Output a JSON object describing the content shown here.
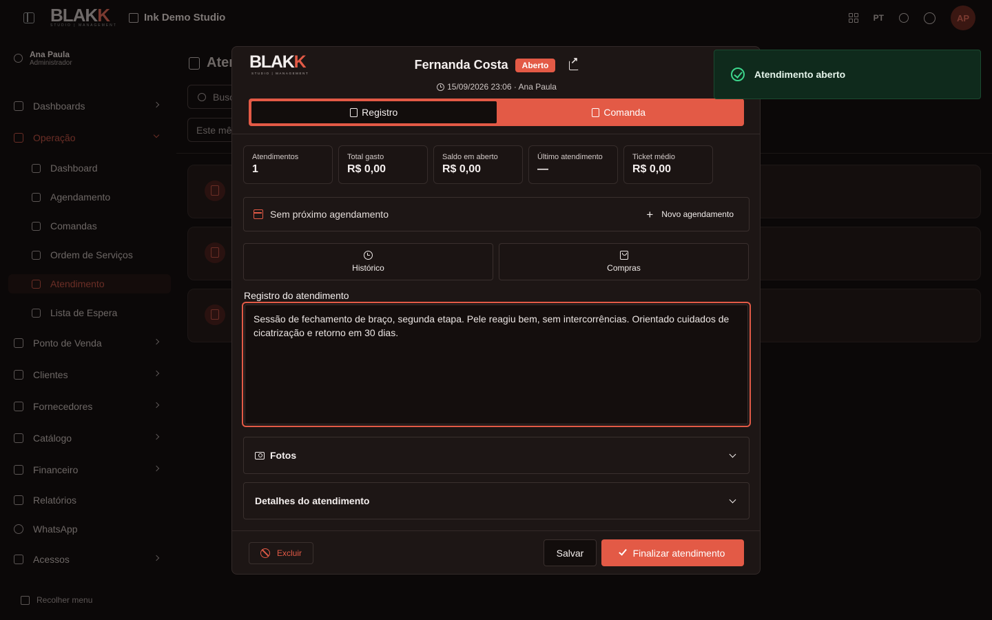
{
  "topbar": {
    "logo_main": "BLAK",
    "logo_accent": "K",
    "logo_sub": "STUDIO | MANAGEMENT",
    "studio_name": "Ink Demo Studio",
    "language": "PT",
    "avatar_initials": "AP"
  },
  "sidebar": {
    "user_name": "Ana Paula",
    "user_role": "Administrador",
    "items": {
      "dashboards": "Dashboards",
      "operacao": "Operação",
      "ponto_venda": "Ponto de Venda",
      "clientes": "Clientes",
      "fornecedores": "Fornecedores",
      "catalogo": "Catálogo",
      "financeiro": "Financeiro",
      "relatorios": "Relatórios",
      "whatsapp": "WhatsApp",
      "acessos": "Acessos"
    },
    "sub_items": {
      "dashboard": "Dashboard",
      "agendamento": "Agendamento",
      "comandas": "Comandas",
      "ordem_servicos": "Ordem de Serviços",
      "atendimento": "Atendimento",
      "lista_espera": "Lista de Espera"
    },
    "collapse_label": "Recolher menu"
  },
  "background": {
    "page_title": "Ater",
    "search_placeholder": "Busc",
    "filter_value": "Este mê"
  },
  "toast": {
    "message": "Atendimento aberto"
  },
  "modal": {
    "logo_main": "BLAK",
    "logo_accent": "K",
    "logo_sub": "STUDIO | MANAGEMENT",
    "client_name": "Fernanda Costa",
    "status": "Aberto",
    "datetime_author": "15/09/2026 23:06 · Ana Paula",
    "tabs": {
      "registro": "Registro",
      "comanda": "Comanda"
    },
    "stats": [
      {
        "label": "Atendimentos",
        "value": "1"
      },
      {
        "label": "Total gasto",
        "value": "R$ 0,00"
      },
      {
        "label": "Saldo em aberto",
        "value": "R$ 0,00"
      },
      {
        "label": "Último atendimento",
        "value": "—"
      },
      {
        "label": "Ticket médio",
        "value": "R$ 0,00"
      }
    ],
    "next_appointment": "Sem próximo agendamento",
    "new_appointment_label": "Novo agendamento",
    "history_label": "Histórico",
    "purchases_label": "Compras",
    "notes_label": "Registro do atendimento",
    "notes_value": "Sessão de fechamento de braço, segunda etapa. Pele reagiu bem, sem intercorrências. Orientado cuidados de cicatrização e retorno em 30 dias.",
    "photos_label": "Fotos",
    "details_label": "Detalhes do atendimento",
    "delete_label": "Excluir",
    "save_label": "Salvar",
    "finish_label": "Finalizar atendimento"
  },
  "colors": {
    "accent": "#e35a46",
    "toast_bg": "#0f2a1c",
    "toast_icon": "#3dd68c",
    "modal_bg": "#1d1615"
  }
}
